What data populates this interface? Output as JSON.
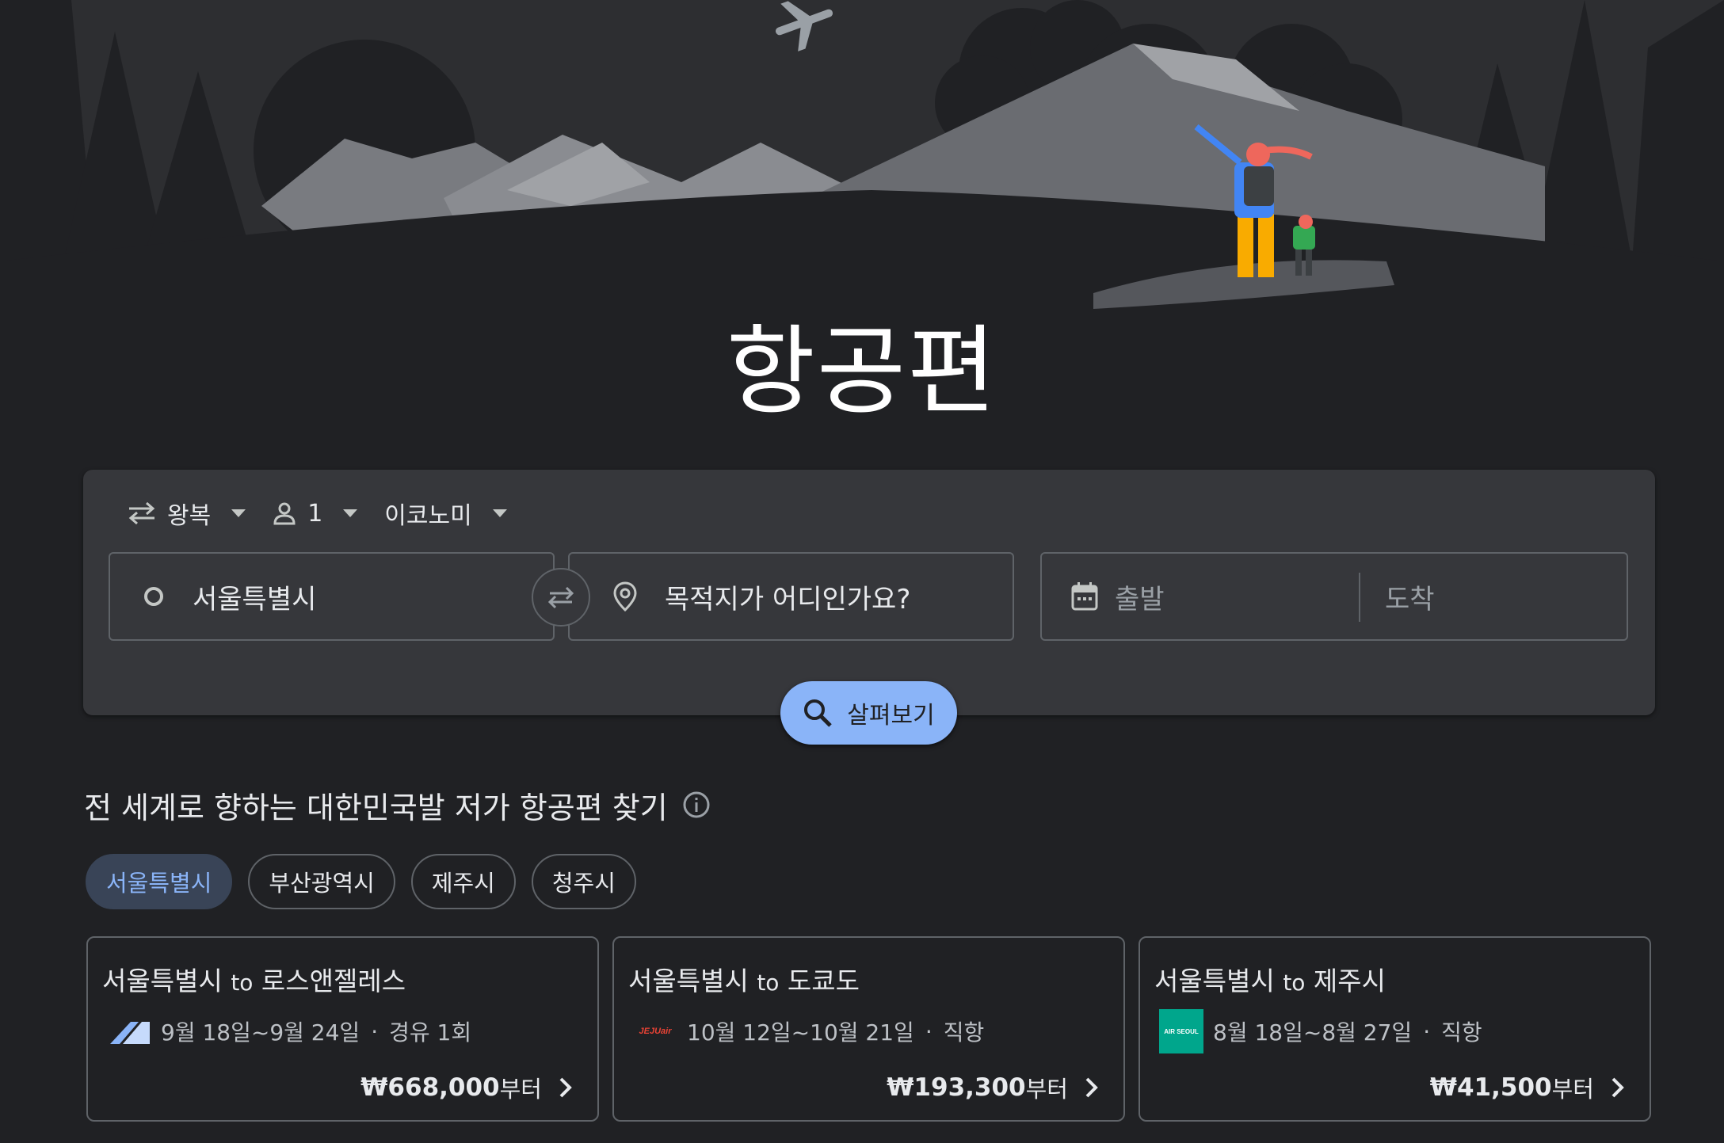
{
  "page": {
    "title": "항공편"
  },
  "trip_options": {
    "trip_type": "왕복",
    "passengers": "1",
    "cabin_class": "이코노미"
  },
  "search": {
    "origin": "서울특별시",
    "destination_placeholder": "목적지가 어디인가요?",
    "departure_placeholder": "출발",
    "return_placeholder": "도착",
    "explore_label": "살펴보기"
  },
  "section": {
    "title": "전 세계로 향하는 대한민국발 저가 항공편 찾기"
  },
  "chips": [
    {
      "label": "서울특별시",
      "active": true
    },
    {
      "label": "부산광역시",
      "active": false
    },
    {
      "label": "제주시",
      "active": false
    },
    {
      "label": "청주시",
      "active": false
    }
  ],
  "cards": [
    {
      "from": "서울특별시",
      "to_word": "to",
      "to": "로스앤젤레스",
      "dates": "9월 18일~9월 24일",
      "stops": "경유 1회",
      "price": "₩668,000",
      "price_suffix": "부터",
      "airline_icon": "korean-air-logo-icon"
    },
    {
      "from": "서울특별시",
      "to_word": "to",
      "to": "도쿄도",
      "dates": "10월 12일~10월 21일",
      "stops": "직항",
      "price": "₩193,300",
      "price_suffix": "부터",
      "airline_icon": "jejuair-logo-icon",
      "airline_logo_text": "JEJUair"
    },
    {
      "from": "서울특별시",
      "to_word": "to",
      "to": "제주시",
      "dates": "8월 18일~8월 27일",
      "stops": "직항",
      "price": "₩41,500",
      "price_suffix": "부터",
      "airline_icon": "air-seoul-logo-icon",
      "airline_logo_text": "AIR SEOUL"
    }
  ],
  "colors": {
    "background": "#202124",
    "panel": "#36373b",
    "accent": "#8ab4f8",
    "chip_active_bg": "#394457",
    "border": "#5f6368"
  }
}
